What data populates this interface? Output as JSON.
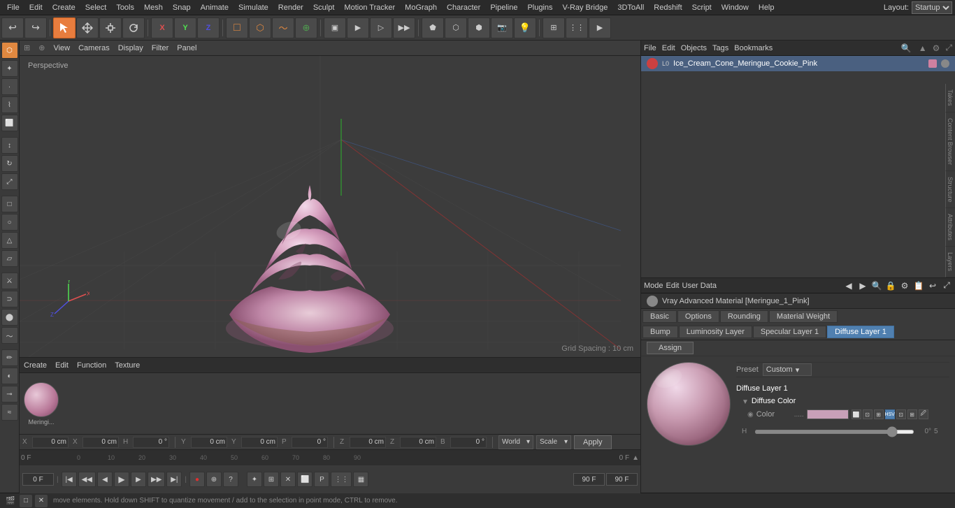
{
  "menubar": {
    "items": [
      "File",
      "Edit",
      "Create",
      "Select",
      "Tools",
      "Mesh",
      "Snap",
      "Animate",
      "Simulate",
      "Render",
      "Sculpt",
      "Motion Tracker",
      "MoGraph",
      "Character",
      "Pipeline",
      "Plugins",
      "V-Ray Bridge",
      "3DToAll",
      "Redshift",
      "Script",
      "Window",
      "Help"
    ],
    "layout_label": "Layout:",
    "layout_value": "Startup"
  },
  "toolbar": {
    "undo_label": "↩",
    "move_label": "↔",
    "scale_label": "⤢",
    "rotate_label": "↻",
    "tools": [
      "↩",
      "▷",
      "⊞",
      "↔",
      "⤢",
      "↻",
      "✦",
      "◉",
      "⬟",
      "⬡",
      "⬛",
      "▶",
      "▶▶",
      "⬜",
      "⬡",
      "⬢",
      "◈",
      "⊕",
      "★",
      "⬡"
    ]
  },
  "viewport": {
    "label": "Perspective",
    "menus": [
      "View",
      "Cameras",
      "Display",
      "Filter",
      "Panel"
    ],
    "grid_spacing": "Grid Spacing : 10 cm"
  },
  "timeline": {
    "frame_current": "0 F",
    "frame_end": "90 F",
    "frame_start": "0 F",
    "ticks": [
      "0",
      "",
      "10",
      "",
      "20",
      "",
      "30",
      "",
      "40",
      "",
      "50",
      "",
      "60",
      "",
      "70",
      "",
      "80",
      "",
      "90"
    ],
    "frame_indicator": "0 F"
  },
  "coord_bar": {
    "x_pos": "0 cm",
    "y_pos": "0 cm",
    "z_pos": "0 cm",
    "x_size": "0 cm",
    "y_size": "0 cm",
    "z_size": "0 cm",
    "h_rot": "0 °",
    "p_rot": "0 °",
    "b_rot": "0 °",
    "world_label": "World",
    "scale_label": "Scale",
    "apply_label": "Apply"
  },
  "obj_manager": {
    "menus": [
      "File",
      "Edit",
      "Objects",
      "Tags",
      "Bookmarks"
    ],
    "search_icon": "🔍",
    "obj_name": "Ice_Cream_Cone_Meringue_Cookie_Pink"
  },
  "mat_manager": {
    "title": "Vray Advanced Material [Meringue_1_Pink]",
    "tabs": {
      "row1": [
        "Basic",
        "Options",
        "Rounding",
        "Material Weight"
      ],
      "row2": [
        "Bump",
        "Luminosity Layer",
        "Specular Layer 1",
        "Diffuse Layer 1"
      ]
    },
    "assign_label": "Assign",
    "preset_label": "Preset",
    "preset_value": "Custom",
    "mode_label": "Mode",
    "edit_label": "Edit",
    "user_data_label": "User Data",
    "diffuse_layer": "Diffuse Layer 1",
    "diffuse_color": "Diffuse Color",
    "color_label": "Color",
    "color_dots": ".....",
    "color_options": [
      "HSV"
    ],
    "mode_btn_icons": [
      "◀",
      "▶",
      "🔍",
      "🔒",
      "⚙",
      "📋",
      "↩",
      "⬜",
      "▦"
    ],
    "panel_icons": [
      "◀",
      "▼",
      "🔍",
      "⚙",
      "📋",
      "↩"
    ]
  },
  "material_editor": {
    "menus": [
      "Create",
      "Edit",
      "Function",
      "Texture"
    ],
    "mat_name": "Meringi..."
  },
  "statusbar": {
    "text": "move elements. Hold down SHIFT to quantize movement / add to the selection in point mode, CTRL to remove.",
    "icons": [
      "●",
      "□",
      "✕"
    ]
  },
  "side_tabs": [
    "Takes",
    "Content Browser",
    "Structure",
    "Attributes",
    "Layers"
  ],
  "bottom_status": {
    "text": "move elements. Hold down SHIFT to quantize movement / add to the selection in point mode, CTRL to remove."
  }
}
